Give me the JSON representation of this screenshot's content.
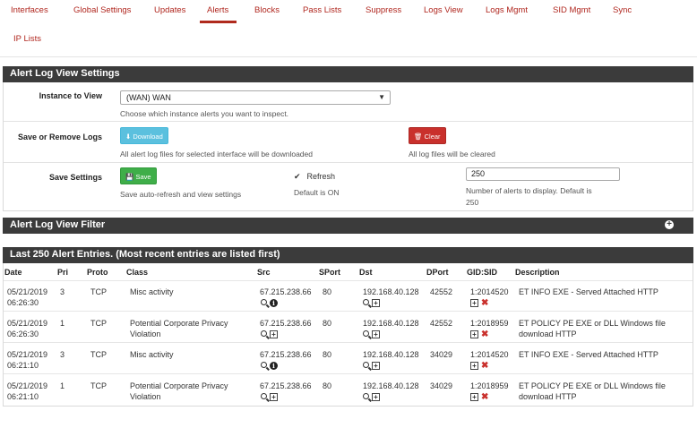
{
  "tabs": [
    {
      "label": "Interfaces"
    },
    {
      "label": "Global Settings"
    },
    {
      "label": "Updates"
    },
    {
      "label": "Alerts",
      "active": true
    },
    {
      "label": "Blocks"
    },
    {
      "label": "Pass Lists"
    },
    {
      "label": "Suppress"
    },
    {
      "label": "Logs View"
    },
    {
      "label": "Logs Mgmt"
    },
    {
      "label": "SID Mgmt"
    },
    {
      "label": "Sync"
    },
    {
      "label": "IP Lists"
    }
  ],
  "settings": {
    "title": "Alert Log View Settings",
    "instance_label": "Instance to View",
    "instance_value": "(WAN) WAN",
    "instance_help": "Choose which instance alerts you want to inspect.",
    "save_remove_label": "Save or Remove Logs",
    "download_btn": "Download",
    "download_help": "All alert log files for selected interface will be downloaded",
    "clear_btn": "Clear",
    "clear_help": "All log files will be cleared",
    "save_settings_label": "Save Settings",
    "save_btn": "Save",
    "save_help": "Save auto-refresh and view settings",
    "refresh_label": "Refresh",
    "refresh_checked": true,
    "refresh_help": "Default is ON",
    "num_alerts_value": "250",
    "num_alerts_help_1": "Number of alerts to display. Default is",
    "num_alerts_help_2": "250"
  },
  "filter": {
    "title": "Alert Log View Filter"
  },
  "entries": {
    "title": "Last 250 Alert Entries. (Most recent entries are listed first)",
    "columns": [
      "Date",
      "Pri",
      "Proto",
      "Class",
      "Src",
      "SPort",
      "Dst",
      "DPort",
      "GID:SID",
      "Description"
    ],
    "rows": [
      {
        "date1": "05/21/2019",
        "date2": "06:26:30",
        "pri": "3",
        "proto": "TCP",
        "class1": "Misc activity",
        "class2": "",
        "src": "67.215.238.66",
        "sport": "80",
        "dst": "192.168.40.128",
        "dport": "42552",
        "gidsid": "1:2014520",
        "desc1": "ET INFO EXE - Served Attached HTTP",
        "desc2": "",
        "src_info": true
      },
      {
        "date1": "05/21/2019",
        "date2": "06:26:30",
        "pri": "1",
        "proto": "TCP",
        "class1": "Potential Corporate Privacy",
        "class2": "Violation",
        "src": "67.215.238.66",
        "sport": "80",
        "dst": "192.168.40.128",
        "dport": "42552",
        "gidsid": "1:2018959",
        "desc1": "ET POLICY PE EXE or DLL Windows file",
        "desc2": "download HTTP",
        "src_info": false
      },
      {
        "date1": "05/21/2019",
        "date2": "06:21:10",
        "pri": "3",
        "proto": "TCP",
        "class1": "Misc activity",
        "class2": "",
        "src": "67.215.238.66",
        "sport": "80",
        "dst": "192.168.40.128",
        "dport": "34029",
        "gidsid": "1:2014520",
        "desc1": "ET INFO EXE - Served Attached HTTP",
        "desc2": "",
        "src_info": true
      },
      {
        "date1": "05/21/2019",
        "date2": "06:21:10",
        "pri": "1",
        "proto": "TCP",
        "class1": "Potential Corporate Privacy",
        "class2": "Violation",
        "src": "67.215.238.66",
        "sport": "80",
        "dst": "192.168.40.128",
        "dport": "34029",
        "gidsid": "1:2018959",
        "desc1": "ET POLICY PE EXE or DLL Windows file",
        "desc2": "download HTTP",
        "src_info": false
      }
    ]
  }
}
